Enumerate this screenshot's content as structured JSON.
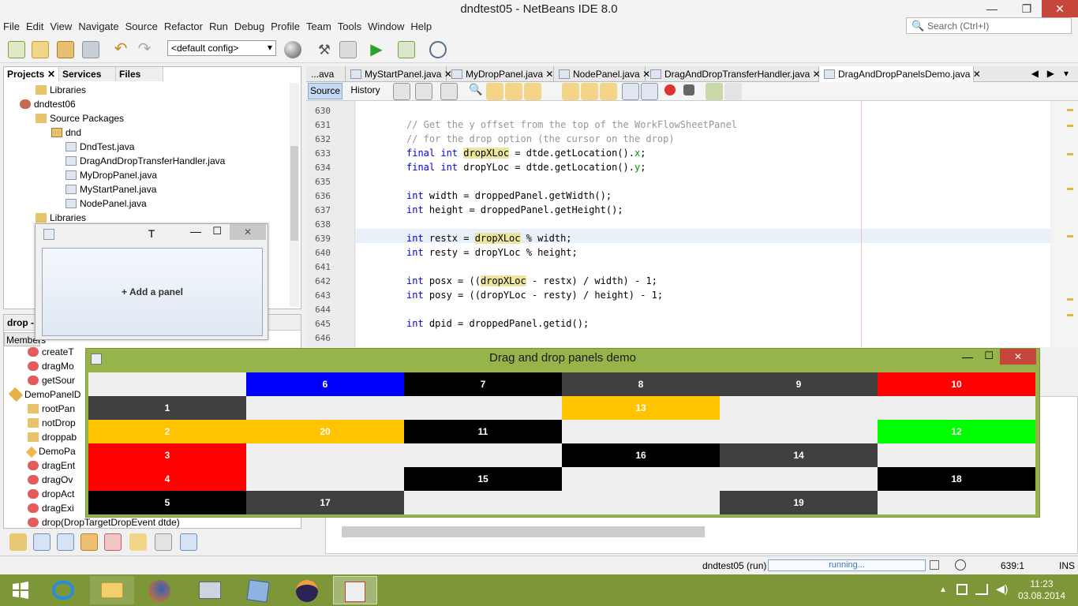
{
  "window": {
    "title": "dndtest05 - NetBeans IDE 8.0"
  },
  "menu": [
    "File",
    "Edit",
    "View",
    "Navigate",
    "Source",
    "Refactor",
    "Run",
    "Debug",
    "Profile",
    "Team",
    "Tools",
    "Window",
    "Help"
  ],
  "search": {
    "placeholder": "Search (Ctrl+I)"
  },
  "toolbar": {
    "config": "<default config>"
  },
  "left_tabs": [
    "Projects",
    "Services",
    "Files"
  ],
  "tree": [
    {
      "label": "Libraries",
      "indent": 1
    },
    {
      "label": "dndtest06",
      "indent": 0
    },
    {
      "label": "Source Packages",
      "indent": 1
    },
    {
      "label": "dnd",
      "indent": 2
    },
    {
      "label": "DndTest.java",
      "indent": 3
    },
    {
      "label": "DragAndDropTransferHandler.java",
      "indent": 3
    },
    {
      "label": "MyDropPanel.java",
      "indent": 3
    },
    {
      "label": "MyStartPanel.java",
      "indent": 3
    },
    {
      "label": "NodePanel.java",
      "indent": 3
    },
    {
      "label": "Libraries",
      "indent": 1
    }
  ],
  "small_window": {
    "title": "T",
    "button": "+ Add a panel"
  },
  "navigator": {
    "title": "drop -",
    "filter": "Members",
    "items": [
      "createT",
      "dragMo",
      "getSour",
      "DemoPanelD",
      "rootPan",
      "notDrop",
      "droppab",
      "DemoPa",
      "dragEnt",
      "dragOv",
      "dropAct",
      "dragExi",
      "drop(DropTargetDropEvent dtde)"
    ]
  },
  "editor_tabs": [
    "...ava",
    "MyStartPanel.java",
    "MyDropPanel.java",
    "NodePanel.java",
    "DragAndDropTransferHandler.java",
    "DragAndDropPanelsDemo.java"
  ],
  "editor_subtabs": {
    "source": "Source",
    "history": "History"
  },
  "code": [
    {
      "n": "630",
      "parts": []
    },
    {
      "n": "631",
      "parts": [
        {
          "t": "// Get the y offset from the top of the WorkFlowSheetPanel",
          "c": "cm"
        }
      ]
    },
    {
      "n": "632",
      "parts": [
        {
          "t": "// for the drop option (the cursor on the drop)",
          "c": "cm"
        }
      ]
    },
    {
      "n": "633",
      "parts": [
        {
          "t": "final int ",
          "c": "kw"
        },
        {
          "t": "dropXLoc",
          "c": "hl"
        },
        {
          "t": " = dtde.getLocation()."
        },
        {
          "t": "x",
          "c": "fd"
        },
        {
          "t": ";"
        }
      ]
    },
    {
      "n": "634",
      "parts": [
        {
          "t": "final int ",
          "c": "kw"
        },
        {
          "t": "dropYLoc = dtde.getLocation()."
        },
        {
          "t": "y",
          "c": "fd"
        },
        {
          "t": ";"
        }
      ]
    },
    {
      "n": "635",
      "parts": []
    },
    {
      "n": "636",
      "parts": [
        {
          "t": "int ",
          "c": "kw"
        },
        {
          "t": "width = droppedPanel.getWidth();"
        }
      ]
    },
    {
      "n": "637",
      "parts": [
        {
          "t": "int ",
          "c": "kw"
        },
        {
          "t": "height = droppedPanel.getHeight();"
        }
      ]
    },
    {
      "n": "638",
      "parts": []
    },
    {
      "n": "639",
      "parts": [
        {
          "t": "int ",
          "c": "kw"
        },
        {
          "t": "restx = "
        },
        {
          "t": "dropXLoc",
          "c": "hl"
        },
        {
          "t": " % width;"
        }
      ]
    },
    {
      "n": "640",
      "parts": [
        {
          "t": "int ",
          "c": "kw"
        },
        {
          "t": "resty = dropYLoc % height;"
        }
      ]
    },
    {
      "n": "641",
      "parts": []
    },
    {
      "n": "642",
      "parts": [
        {
          "t": "int ",
          "c": "kw"
        },
        {
          "t": "posx = (("
        },
        {
          "t": "dropXLoc",
          "c": "hl"
        },
        {
          "t": " - restx) / width) - 1;"
        }
      ]
    },
    {
      "n": "643",
      "parts": [
        {
          "t": "int ",
          "c": "kw"
        },
        {
          "t": "posy = ((dropYLoc - resty) / height) - 1;"
        }
      ]
    },
    {
      "n": "644",
      "parts": []
    },
    {
      "n": "645",
      "parts": [
        {
          "t": "int ",
          "c": "kw"
        },
        {
          "t": "dpid = droppedPanel.getid();"
        }
      ]
    },
    {
      "n": "646",
      "parts": []
    }
  ],
  "demo": {
    "title": "Drag and drop panels demo",
    "cells": [
      {
        "row": 0,
        "col": 1,
        "label": "6",
        "color": "#0000ff"
      },
      {
        "row": 0,
        "col": 2,
        "label": "7",
        "color": "#000000"
      },
      {
        "row": 0,
        "col": 3,
        "label": "8",
        "color": "#404040"
      },
      {
        "row": 0,
        "col": 4,
        "label": "9",
        "color": "#404040"
      },
      {
        "row": 0,
        "col": 5,
        "label": "10",
        "color": "#ff0000"
      },
      {
        "row": 1,
        "col": 0,
        "label": "1",
        "color": "#404040"
      },
      {
        "row": 1,
        "col": 3,
        "label": "13",
        "color": "#ffc300"
      },
      {
        "row": 2,
        "col": 0,
        "label": "2",
        "color": "#ffc300"
      },
      {
        "row": 2,
        "col": 1,
        "label": "20",
        "color": "#ffc300"
      },
      {
        "row": 2,
        "col": 2,
        "label": "11",
        "color": "#000000"
      },
      {
        "row": 2,
        "col": 5,
        "label": "12",
        "color": "#00ff00"
      },
      {
        "row": 3,
        "col": 0,
        "label": "3",
        "color": "#ff0000"
      },
      {
        "row": 3,
        "col": 3,
        "label": "16",
        "color": "#000000"
      },
      {
        "row": 3,
        "col": 4,
        "label": "14",
        "color": "#404040"
      },
      {
        "row": 4,
        "col": 0,
        "label": "4",
        "color": "#ff0000"
      },
      {
        "row": 4,
        "col": 2,
        "label": "15",
        "color": "#000000"
      },
      {
        "row": 4,
        "col": 5,
        "label": "18",
        "color": "#000000"
      },
      {
        "row": 5,
        "col": 0,
        "label": "5",
        "color": "#000000"
      },
      {
        "row": 5,
        "col": 1,
        "label": "17",
        "color": "#404040"
      },
      {
        "row": 5,
        "col": 4,
        "label": "19",
        "color": "#404040"
      }
    ]
  },
  "status": {
    "project": "dndtest05 (run)",
    "progress": "running...",
    "position": "639:1",
    "mode": "INS"
  },
  "clock": {
    "time": "11:23",
    "date": "03.08.2014"
  }
}
